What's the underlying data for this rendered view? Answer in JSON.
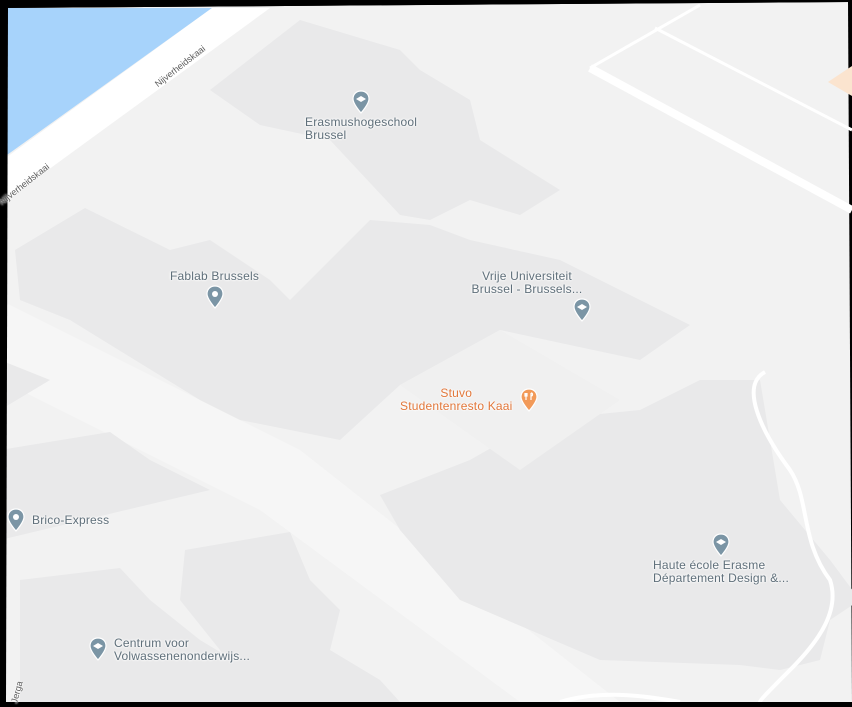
{
  "colors": {
    "background": "#f2f2f2",
    "building": "#e9e9ea",
    "water": "#a7d3fb",
    "road": "#ffffff",
    "poi_blue": "#7b95a5",
    "poi_food": "#f29a59"
  },
  "streets": {
    "kaai_1": "Nijverheidskaai",
    "kaai_2": "Nijverheidskaai",
    "bottom_left": "Jerga"
  },
  "places": {
    "erasmus": {
      "label": "Erasmushogeschool\nBrussel",
      "icon": "school-pin-icon"
    },
    "fablab": {
      "label": "Fablab Brussels",
      "icon": "pin-icon"
    },
    "vub": {
      "label": "Vrije Universiteit\nBrussel - Brussels...",
      "icon": "school-pin-icon"
    },
    "stuvo": {
      "label": "Stuvo\nStudentenresto Kaai",
      "icon": "restaurant-pin-icon"
    },
    "brico": {
      "label": "Brico-Express",
      "icon": "pin-icon"
    },
    "haute": {
      "label": "Haute école Erasme\nDépartement Design &...",
      "icon": "school-pin-icon"
    },
    "centrum": {
      "label": "Centrum voor\nVolwassenenonderwijs...",
      "icon": "school-pin-icon"
    }
  }
}
